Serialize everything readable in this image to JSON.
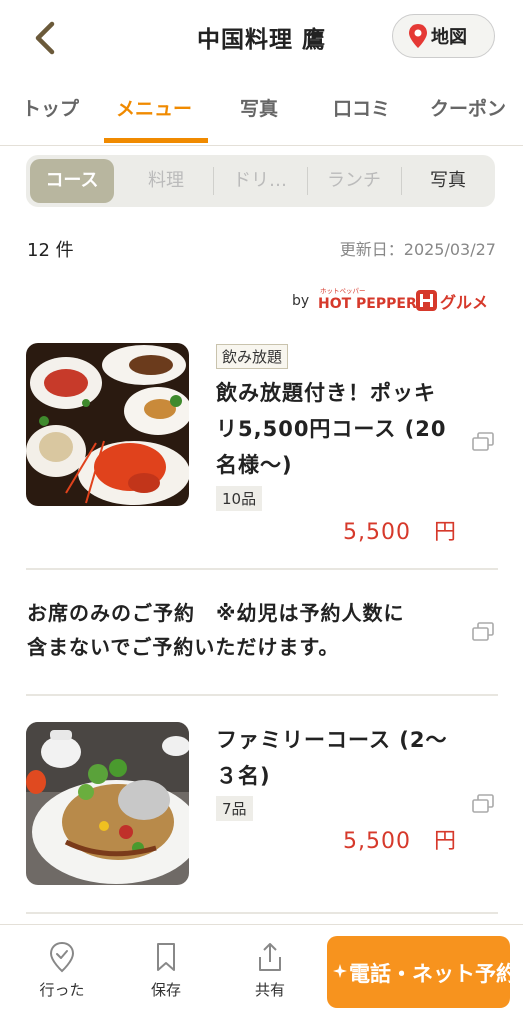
{
  "header": {
    "title": "中国料理 鷹",
    "map_label": "地図"
  },
  "tabs": [
    {
      "label": "トップ"
    },
    {
      "label": "メニュー"
    },
    {
      "label": "写真"
    },
    {
      "label": "口コミ"
    },
    {
      "label": "クーポン"
    }
  ],
  "segments": [
    {
      "label": "コース"
    },
    {
      "label": "料理"
    },
    {
      "label": "ドリ…"
    },
    {
      "label": "ランチ"
    },
    {
      "label": "写真"
    }
  ],
  "list": {
    "count": "12 件",
    "updated": "更新日：2025/03/27",
    "by": "by",
    "provider_logo_text": "HOT PEPPER グルメ"
  },
  "items": [
    {
      "tag": "飲み放題",
      "name_lines": [
        "飲み放題付き！ポッキ",
        "リ5,500円コース (20",
        "名様〜)"
      ],
      "dishes": "10品",
      "price": "5,500　円"
    },
    {
      "name_lines": [
        "ファミリーコース (2〜",
        "３名)"
      ],
      "dishes": "7品",
      "price": "5,500　円"
    }
  ],
  "notice": {
    "line1": "お席のみのご予約　※幼児は予約人数に",
    "line2": "含まないでご予約いただけます。"
  },
  "bottom": {
    "went": "行った",
    "save": "保存",
    "share": "共有",
    "reserve": "電話・ネット予約"
  },
  "colors": {
    "accent": "#f08a00",
    "price": "#d6392b",
    "cta": "#f7931e",
    "segment_active": "#b8b69f"
  }
}
